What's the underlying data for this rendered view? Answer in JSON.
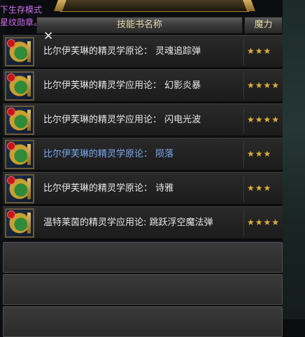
{
  "labels": {
    "mode": "下生存模式",
    "medal": "星纹勋章。"
  },
  "table": {
    "header_name": "技能书名称",
    "header_power": "魔力"
  },
  "rows": [
    {
      "name": "比尔伊芙琳的精灵学原论： 灵魂追踪弹",
      "stars": "★★★",
      "highlight": false
    },
    {
      "name": "比尔伊芙琳的精灵学应用论： 幻影炎暴",
      "stars": "★★★★",
      "highlight": false
    },
    {
      "name": "比尔伊芙琳的精灵学应用论： 闪电光波",
      "stars": "★★★★",
      "highlight": false
    },
    {
      "name": "比尔伊芙琳的精灵学原论： 陨落",
      "stars": "★★★",
      "highlight": true
    },
    {
      "name": "比尔伊芙琳的精灵学原论： 诗雅",
      "stars": "★★★",
      "highlight": false
    },
    {
      "name": "温特莱茵的精灵学应用论: 跳跃浮空魔法弹",
      "stars": "★★★★",
      "highlight": false
    }
  ],
  "icons": {
    "close": "✕",
    "book": "skill-book-icon",
    "badge": "red-lock-icon"
  },
  "colors": {
    "name_default": "#e8e8e8",
    "name_highlight": "#7aaaf0",
    "stars": "#e0b040",
    "header_text": "#e6d9a8",
    "mode_label": "#d36cf5"
  }
}
